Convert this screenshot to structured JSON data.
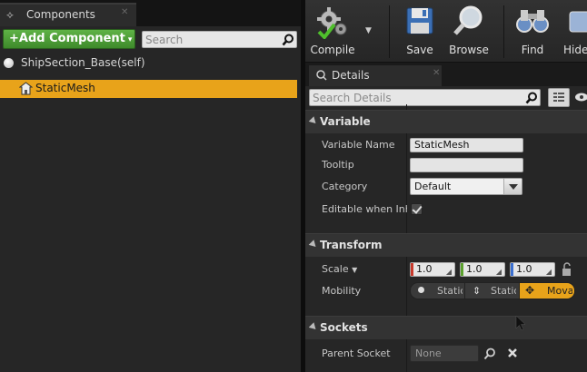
{
  "components_panel": {
    "tab_label": "Components",
    "add_component_label": "Add Component",
    "search_placeholder": "Search",
    "tree": {
      "root_label": "ShipSection_Base(self)",
      "items": [
        {
          "label": "StaticMesh",
          "selected": true
        }
      ]
    }
  },
  "toolbar": {
    "buttons": [
      {
        "label": "Compile",
        "icon": "compile-gears-icon"
      },
      {
        "label": "Save",
        "icon": "save-disk-icon"
      },
      {
        "label": "Browse",
        "icon": "browse-magnifier-icon"
      },
      {
        "label": "Find",
        "icon": "find-binoculars-icon"
      },
      {
        "label": "Hide",
        "icon": "hide-icon"
      }
    ]
  },
  "details_panel": {
    "tab_label": "Details",
    "search_placeholder": "Search Details",
    "categories": {
      "variable": {
        "title": "Variable",
        "variable_name_label": "Variable Name",
        "variable_name_value": "StaticMesh",
        "tooltip_label": "Tooltip",
        "tooltip_value": "",
        "category_label": "Category",
        "category_value": "Default",
        "editable_label": "Editable when Inherited",
        "editable_checked": true
      },
      "transform": {
        "title": "Transform",
        "scale_label": "Scale",
        "scale_values": [
          "1.0",
          "1.0",
          "1.0"
        ],
        "mobility_label": "Mobility",
        "mobility_options": [
          "Static",
          "Stationary",
          "Movable"
        ],
        "mobility_selected": "Movable"
      },
      "sockets": {
        "title": "Sockets",
        "parent_socket_label": "Parent Socket",
        "parent_socket_value": "None"
      }
    }
  },
  "colors": {
    "selection_accent": "#e8a31a",
    "add_button_green": "#4e9e37",
    "axis_x": "#c8392b",
    "axis_y": "#5aa02c",
    "axis_z": "#3a6fd0"
  }
}
